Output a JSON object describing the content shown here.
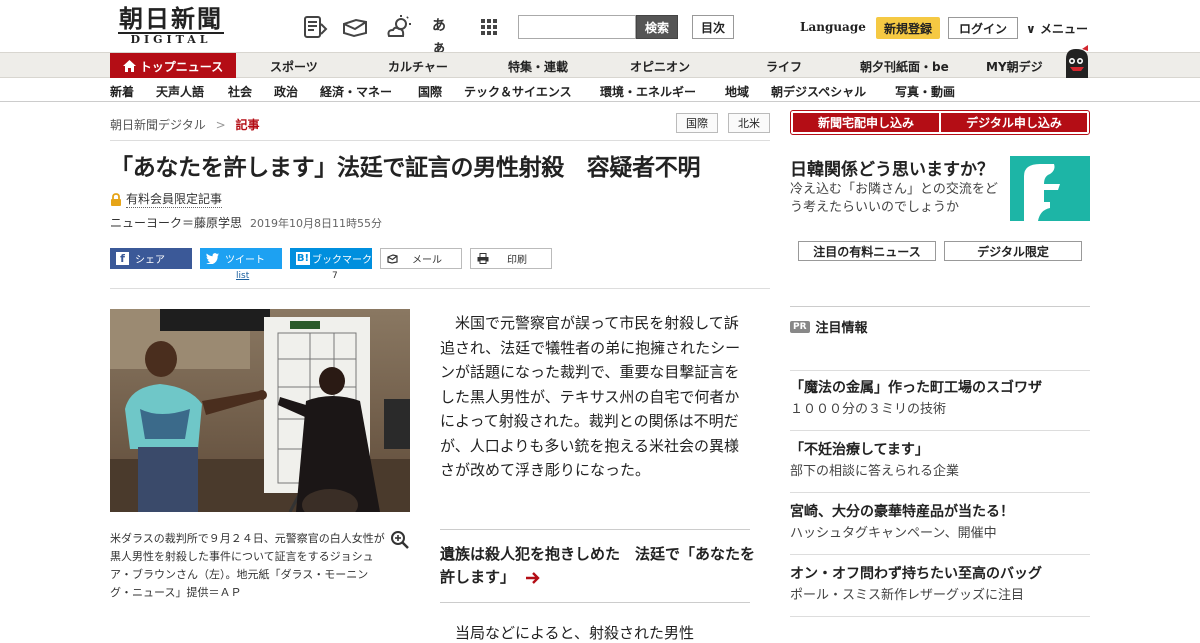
{
  "header": {
    "logo_jp": "朝日新聞",
    "logo_en": "DIGITAL",
    "icons": [
      "paper-icon",
      "mail-icon",
      "weather-icon",
      "font-size-icon",
      "grid-icon"
    ],
    "font_label": "あぁ",
    "search_button": "検索",
    "mokuji": "目次",
    "language": "Language",
    "register": "新規登録",
    "login": "ログイン",
    "menu": "メニュー"
  },
  "nav": {
    "home": "トップニュース",
    "items": [
      "スポーツ",
      "カルチャー",
      "特集・連載",
      "オピニオン",
      "ライフ",
      "朝夕刊紙面・be",
      "MY朝デジ"
    ]
  },
  "subnav": {
    "items": [
      "新着",
      "天声人語",
      "社会",
      "政治",
      "経済・マネー",
      "国際",
      "テック＆サイエンス",
      "環境・エネルギー",
      "地域",
      "朝デジスペシャル",
      "写真・動画"
    ]
  },
  "breadcrumb": {
    "root": "朝日新聞デジタル",
    "sep": ">",
    "current": "記事"
  },
  "tags": [
    "国際",
    "北米"
  ],
  "article": {
    "headline": "「あなたを許します」法廷で証言の男性射殺　容疑者不明",
    "members_only": "有料会員限定記事",
    "byline": "ニューヨーク＝藤原学思",
    "date": "2019年10月8日11時55分",
    "caption": "米ダラスの裁判所で９月２４日、元警察官の白人女性が黒人男性を射殺した事件について証言をするジョシュア・ブラウンさん（左）。地元紙「ダラス・モーニング・ニュース」提供＝ＡＰ",
    "body": "米国で元警察官が誤って市民を射殺して訴追され、法廷で犠牲者の弟に抱擁されたシーンが話題になった裁判で、重要な目撃証言をした黒人男性が、テキサス州の自宅で何者かによって射殺された。裁判との関係は不明だが、人口よりも多い銃を抱える米社会の異様さが改めて浮き彫りになった。",
    "related": "遺族は殺人犯を抱きしめた　法廷で「あなたを許します」",
    "body2": "当局などによると、射殺された男性"
  },
  "share": {
    "facebook": "シェア",
    "twitter": "ツイート",
    "twitter_count": "list",
    "hatena": "ブックマーク",
    "hatena_count": "7",
    "mail": "メール",
    "print": "印刷"
  },
  "sidebar": {
    "sub_delivery": "新聞宅配申し込み",
    "sub_digital": "デジタル申し込み",
    "promo_title": "日韓関係どう思いますか？",
    "promo_text": "冷え込む「お隣さん」との交流をどう考えたらいいのでしょうか",
    "btn_paid": "注目の有料ニュース",
    "btn_digital": "デジタル限定",
    "pr_badge": "PR",
    "pr_title": "注目情報",
    "pr_items": [
      {
        "title": "「魔法の金属」作った町工場のスゴワザ",
        "sub": "１０００分の３ミリの技術"
      },
      {
        "title": "「不妊治療してます」",
        "sub": "部下の相談に答えられる企業"
      },
      {
        "title": "宮崎、大分の豪華特産品が当たる！",
        "sub": "ハッシュタグキャンペーン、開催中"
      },
      {
        "title": "オン・オフ問わず持ちたい至高のバッグ",
        "sub": "ポール・スミス新作レザーグッズに注目"
      }
    ]
  },
  "colors": {
    "brand_red": "#b40d15",
    "teal": "#1db5a6",
    "register_yellow": "#f5c943"
  }
}
